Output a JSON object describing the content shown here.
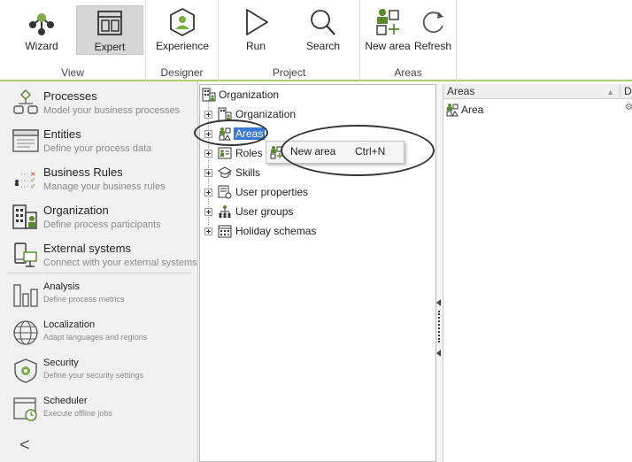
{
  "ribbon": {
    "groups": [
      {
        "label": "View"
      },
      {
        "label": "Designer"
      },
      {
        "label": "Project"
      },
      {
        "label": "Areas"
      }
    ],
    "buttons": {
      "wizard": "Wizard",
      "expert": "Expert",
      "experience": "Experience",
      "run": "Run",
      "search": "Search",
      "new_area": "New area",
      "refresh": "Refresh"
    }
  },
  "nav": {
    "items": [
      {
        "title": "Processes",
        "subtitle": "Model your business processes",
        "icon": "processes-icon"
      },
      {
        "title": "Entities",
        "subtitle": "Define your process data",
        "icon": "entities-icon"
      },
      {
        "title": "Business Rules",
        "subtitle": "Manage your business rules",
        "icon": "business-rules-icon"
      },
      {
        "title": "Organization",
        "subtitle": "Define process participants",
        "icon": "organization-icon"
      },
      {
        "title": "External systems",
        "subtitle": "Connect with your external systems",
        "icon": "external-systems-icon"
      },
      {
        "title": "Analysis",
        "subtitle": "Define process metrics",
        "icon": "analysis-icon"
      },
      {
        "title": "Localization",
        "subtitle": "Adapt languages and regions",
        "icon": "localization-icon"
      },
      {
        "title": "Security",
        "subtitle": "Define your security settings",
        "icon": "security-icon"
      },
      {
        "title": "Scheduler",
        "subtitle": "Execute offline jobs",
        "icon": "scheduler-icon"
      }
    ],
    "collapse_glyph": "<"
  },
  "tree": {
    "root": "Organization",
    "children": [
      "Organization",
      "Areas",
      "Roles",
      "Skills",
      "User properties",
      "User groups",
      "Holiday schemas"
    ]
  },
  "context_menu": {
    "label": "New area",
    "shortcut": "Ctrl+N"
  },
  "list": {
    "columns": [
      "Areas",
      "D"
    ],
    "rows": [
      "Area"
    ]
  },
  "colors": {
    "accent_green": "#a9cf6a",
    "selection_blue": "#3a78d6",
    "icon_green": "#5a8a2a"
  }
}
